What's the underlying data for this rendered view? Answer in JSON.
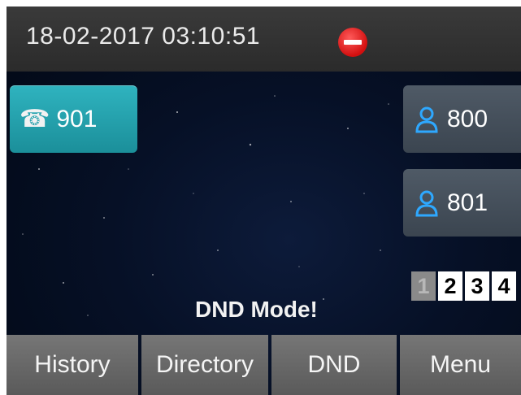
{
  "status_bar": {
    "datetime": "18-02-2017 03:10:51",
    "status_icon": "dnd-icon",
    "status_color": "#d20f0f"
  },
  "line_keys": [
    {
      "label": "901",
      "icon": "phone-icon",
      "color": "#1fa3ae"
    }
  ],
  "contacts": [
    {
      "label": "800",
      "icon": "user-icon"
    },
    {
      "label": "801",
      "icon": "user-icon"
    }
  ],
  "pager": {
    "pages": [
      "1",
      "2",
      "3",
      "4"
    ],
    "current": "1"
  },
  "message": "DND Mode!",
  "softkeys": [
    {
      "label": "History"
    },
    {
      "label": "Directory"
    },
    {
      "label": "DND"
    },
    {
      "label": "Menu"
    }
  ]
}
